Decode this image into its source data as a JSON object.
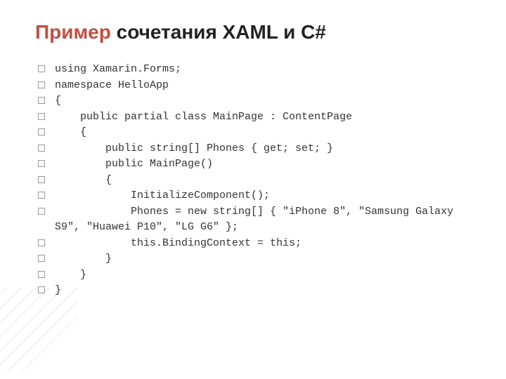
{
  "title": {
    "accent": "Пример",
    "rest": " сочетания XAML и C#"
  },
  "code": [
    "using Xamarin.Forms;",
    "",
    "namespace HelloApp",
    "{",
    "    public partial class MainPage : ContentPage",
    "    {",
    "        public string[] Phones { get; set; }",
    "",
    "        public MainPage()",
    "        {",
    "            InitializeComponent();",
    "            Phones = new string[] { \"iPhone 8\", \"Samsung Galaxy S9\", \"Huawei P10\", \"LG G6\" };",
    "            this.BindingContext = this;",
    "        }",
    "    }",
    "}"
  ]
}
